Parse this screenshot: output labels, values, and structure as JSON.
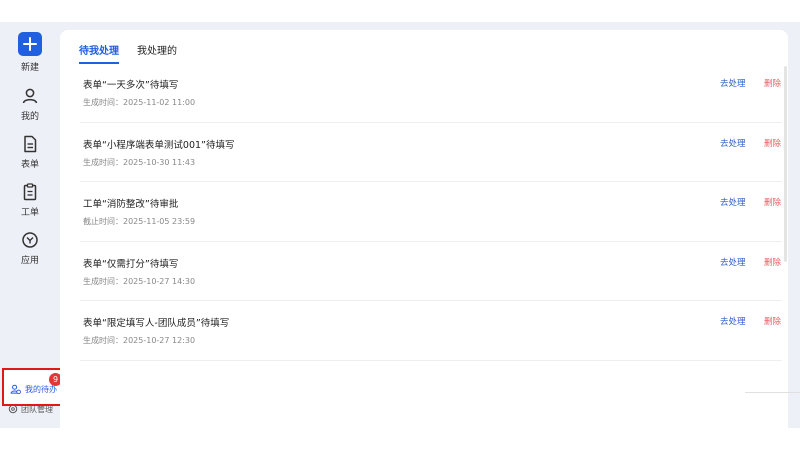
{
  "sidebar": {
    "new_label": "新建",
    "items": [
      {
        "label": "我的",
        "icon": "user-icon"
      },
      {
        "label": "表单",
        "icon": "form-icon"
      },
      {
        "label": "工单",
        "icon": "clipboard-icon"
      },
      {
        "label": "应用",
        "icon": "app-icon"
      }
    ],
    "todo": {
      "label": "我的待办",
      "badge": "9",
      "icon": "todo-people-icon"
    },
    "team": {
      "label": "团队管理",
      "icon": "settings-icon"
    }
  },
  "tabs": [
    {
      "label": "待我处理",
      "active": true
    },
    {
      "label": "我处理的",
      "active": false
    }
  ],
  "tasks": [
    {
      "title": "表单“一天多次”待填写",
      "time": "生成时间：2025-11-02 11:00"
    },
    {
      "title": "表单“小程序端表单测试001”待填写",
      "time": "生成时间：2025-10-30 11:43"
    },
    {
      "title": "工单“消防整改”待审批",
      "time": "截止时间：2025-11-05 23:59"
    },
    {
      "title": "表单“仅需打分”待填写",
      "time": "生成时间：2025-10-27 14:30"
    },
    {
      "title": "表单“限定填写人-团队成员”待填写",
      "time": "生成时间：2025-10-27 12:30"
    }
  ],
  "actions": {
    "process": "去处理",
    "delete": "删除"
  },
  "colors": {
    "accent": "#1f5fe0",
    "delete": "#e86060",
    "badge": "#e53535",
    "highlight_border": "#e01818"
  }
}
